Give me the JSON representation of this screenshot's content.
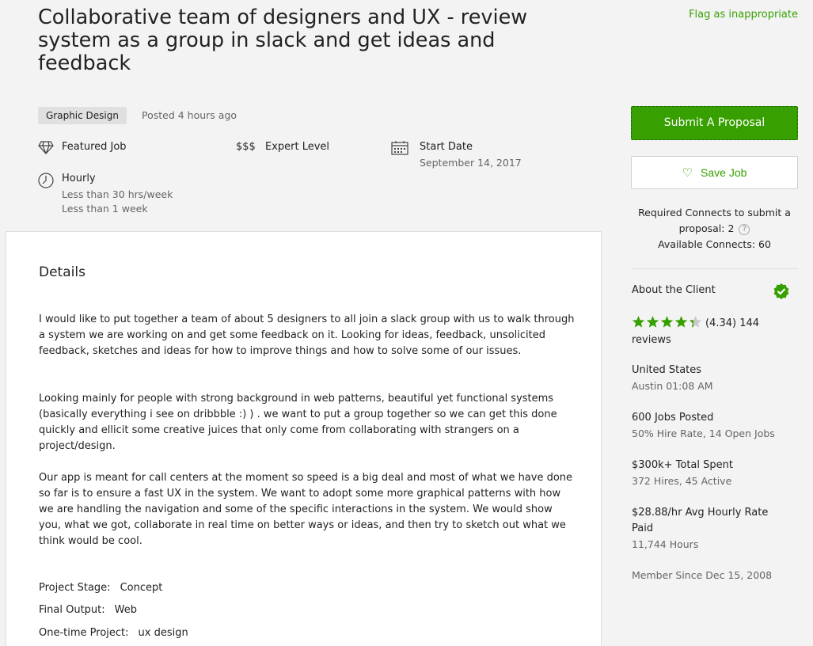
{
  "job": {
    "title": "Collaborative team of designers and UX - review system as a group in slack and get ideas and feedback",
    "flag_label": "Flag as inappropriate",
    "category": "Graphic Design",
    "posted": "Posted 4 hours ago"
  },
  "meta": {
    "featured": "Featured Job",
    "level_icon": "$$$",
    "level": "Expert Level",
    "start_label": "Start Date",
    "start_value": "September 14, 2017",
    "type": "Hourly",
    "hours": "Less than 30 hrs/week",
    "duration": "Less than 1 week"
  },
  "details": {
    "heading": "Details",
    "paragraphs": [
      "I would like to put together a team of about 5 designers to all join a slack group with us to walk through a system we are working on and get some feedback on it. Looking for ideas, feedback, unsolicited feedback, sketches and ideas for how to improve things and how to solve some of our issues.",
      "Looking mainly for people with strong background in web patterns, beautiful yet functional systems (basically everything i see on dribbble :) ) . we want to put a group together so we can get this done quickly and ellicit some creative juices that only come from collaborating with strangers on a project/design.",
      "Our app is meant for call centers at the moment so speed is a big deal and most of what we have done so far is to ensure a fast UX in the system. We want to adopt some more graphical patterns with how we are handling the navigation and some of the specific interactions in the system. We would show you, what we got, collaborate in real time on better ways or ideas, and then try to sketch out what we think would be cool."
    ],
    "props": [
      {
        "key": "Project Stage:",
        "value": "Concept"
      },
      {
        "key": "Final Output:",
        "value": "Web"
      },
      {
        "key": "One-time Project:",
        "value": "ux design"
      }
    ]
  },
  "sidebar": {
    "submit_label": "Submit A Proposal",
    "save_label": "Save Job",
    "connects_line1": "Required Connects to submit a",
    "connects_line2": "proposal: 2",
    "connects_line3": "Available Connects: 60",
    "help_icon": "?"
  },
  "client": {
    "heading": "About the Client",
    "rating": 4.34,
    "rating_text": "(4.34) 144",
    "reviews_word": "reviews",
    "country": "United States",
    "local_time": "Austin 01:08 AM",
    "jobs_posted": "600 Jobs Posted",
    "jobs_sub": "50% Hire Rate, 14 Open Jobs",
    "spent": "$300k+ Total Spent",
    "spent_sub": "372 Hires, 45 Active",
    "avg_rate": "$28.88/hr Avg Hourly Rate Paid",
    "hours": "11,744 Hours",
    "member_since": "Member Since Dec 15, 2008"
  },
  "colors": {
    "accent": "#37a000",
    "muted": "#656565",
    "background": "#f3f3f3"
  }
}
